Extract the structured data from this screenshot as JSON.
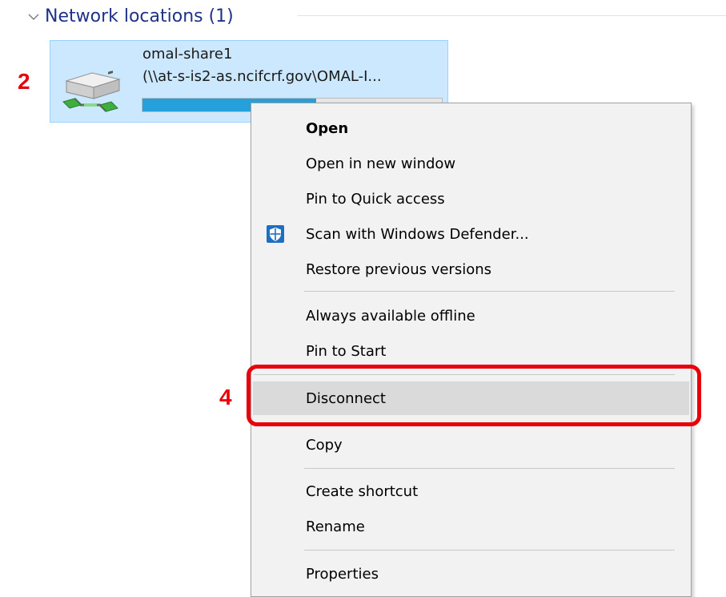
{
  "group": {
    "title": "Network locations (1)"
  },
  "drive": {
    "name": "omal-share1",
    "path": "(\\\\at-s-is2-as.ncifcrf.gov\\OMAL-I...",
    "usage_fraction": 0.58,
    "icon": "network-drive-icon"
  },
  "annotations": {
    "step_a": "2",
    "step_b": "4"
  },
  "menu": {
    "open": "Open",
    "open_new_window": "Open in new window",
    "pin_quick_access": "Pin to Quick access",
    "scan_defender": "Scan with Windows Defender...",
    "restore_versions": "Restore previous versions",
    "always_offline": "Always available offline",
    "pin_start": "Pin to Start",
    "disconnect": "Disconnect",
    "copy": "Copy",
    "create_shortcut": "Create shortcut",
    "rename": "Rename",
    "properties": "Properties"
  },
  "colors": {
    "selection_bg": "#cce8ff",
    "selection_border": "#99d1ff",
    "accent_blue": "#26a0da",
    "highlight_red": "#e8000b",
    "menu_bg": "#f2f2f2",
    "menu_hover": "#dadada"
  }
}
